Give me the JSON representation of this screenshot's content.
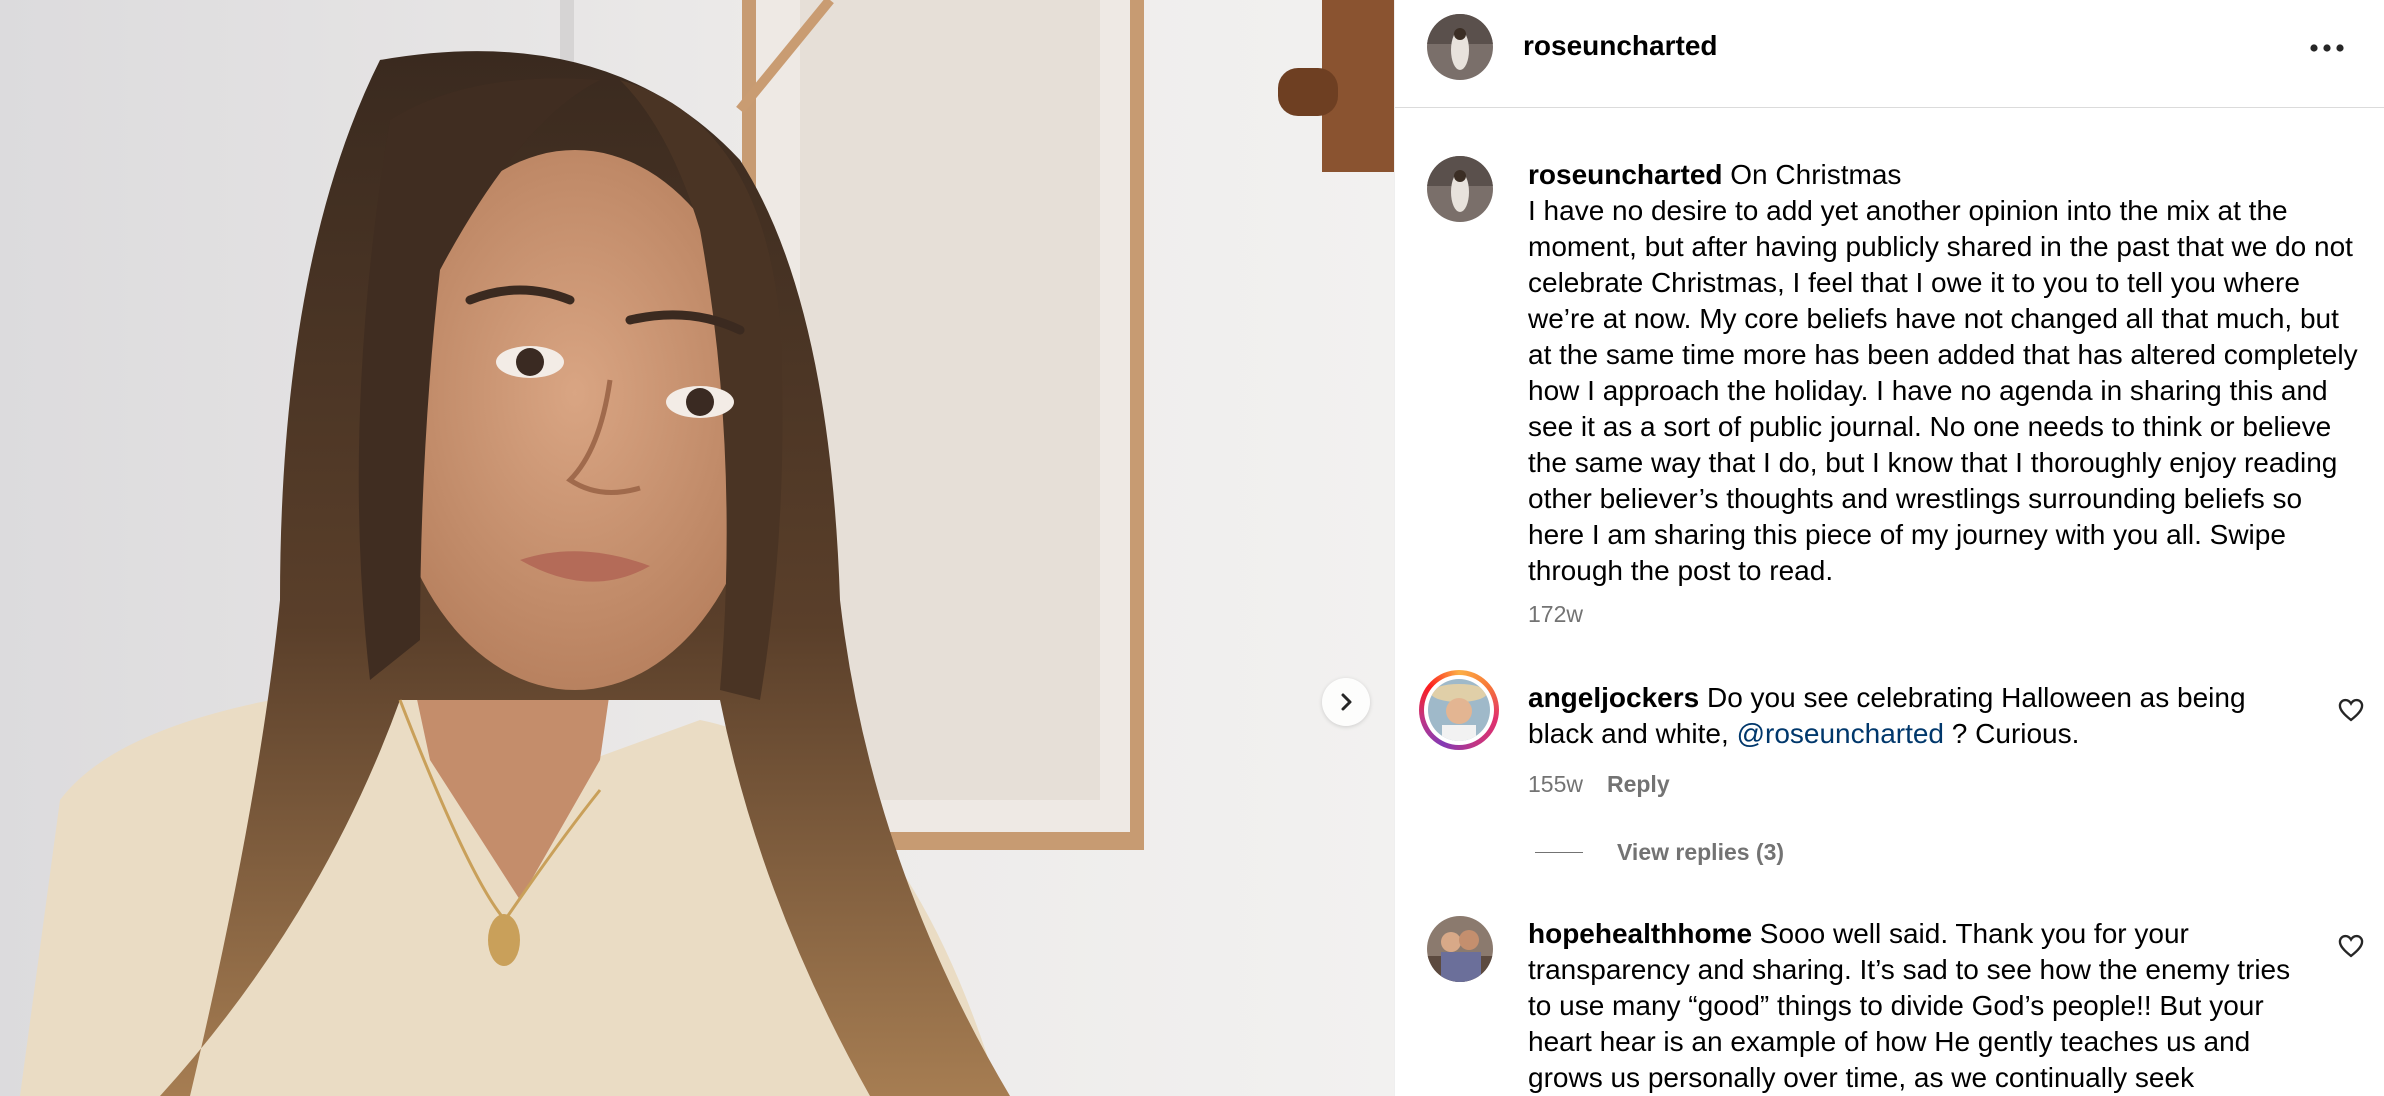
{
  "post": {
    "author": "roseuncharted",
    "more_icon": "more-horizontal-icon",
    "next_icon": "chevron-right-icon"
  },
  "caption": {
    "username": "roseuncharted",
    "text": "On Christmas\nI have no desire to add yet another opinion into the mix at the moment, but after having publicly shared in the past that we do not celebrate Christmas, I feel that I owe it to you to tell you where we’re at now. My core beliefs have not changed all that much, but at the same time more has been added that has altered completely how I approach the holiday. I have no agenda in sharing this and see it as a sort of public journal. No one needs to think or believe the same way that I do, but I know that I thoroughly enjoy reading other believer’s thoughts and wrestlings surrounding beliefs so here I am sharing this piece of my journey with you all. Swipe through the post to read.",
    "time": "172w"
  },
  "comments": [
    {
      "username": "angeljockers",
      "text_before": "Do you see celebrating Halloween as being black and white,",
      "mention": "@roseuncharted",
      "text_after": "? Curious.",
      "time": "155w",
      "reply_label": "Reply",
      "view_replies": "View replies (3)"
    },
    {
      "username": "hopehealthhome",
      "text": "Sooo well said. Thank you for your transparency and sharing. It’s sad to see how the enemy tries to use many “good” things to divide God’s people!! But your heart hear is an example of how He gently teaches us and grows us personally over time, as we continually seek"
    }
  ],
  "colors": {
    "mention": "#00376b",
    "meta": "#737373",
    "divider": "#dbdbdb"
  }
}
